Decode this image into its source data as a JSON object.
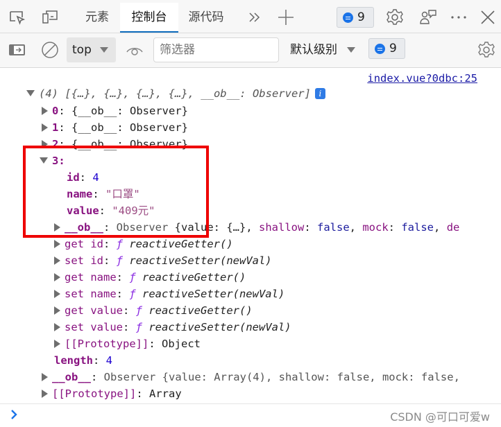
{
  "tabbar": {
    "tabs": [
      {
        "label": "元素",
        "active": false
      },
      {
        "label": "控制台",
        "active": true
      },
      {
        "label": "源代码",
        "active": false
      }
    ],
    "more_tabs_icon": "double-chevron-right-icon",
    "add_tab_icon": "plus-icon",
    "issues_count": "9",
    "accent_color": "#0f6cbd"
  },
  "toolbar": {
    "context": "top",
    "filter_placeholder": "筛选器",
    "levels_label": "默认级别",
    "issues_count": "9"
  },
  "console": {
    "source_link": "index.vue?0dbc:25",
    "summary": "(4) [{…}, {…}, {…}, {…}, __ob__: Observer]",
    "items": [
      {
        "index": "0",
        "preview": "{__ob__: Observer}"
      },
      {
        "index": "1",
        "preview": "{__ob__: Observer}"
      },
      {
        "index": "2",
        "preview": "{__ob__: Observer}"
      }
    ],
    "expanded": {
      "index": "3",
      "props": [
        {
          "key": "id",
          "value": "4"
        },
        {
          "key": "name",
          "value": "\"口罩\""
        },
        {
          "key": "value",
          "value": "\"409元\""
        }
      ],
      "ob_key": "__ob__",
      "ob_type": "Observer",
      "ob_preview_open": "{value: {…}, ",
      "ob_shallow": "shallow",
      "ob_mock": "mock",
      "ob_false": "false",
      "ob_tail": "de",
      "accessors": [
        {
          "label": "get id",
          "fn": "reactiveGetter()"
        },
        {
          "label": "set id",
          "fn": "reactiveSetter(newVal)"
        },
        {
          "label": "get name",
          "fn": "reactiveGetter()"
        },
        {
          "label": "set name",
          "fn": "reactiveSetter(newVal)"
        },
        {
          "label": "get value",
          "fn": "reactiveGetter()"
        },
        {
          "label": "set value",
          "fn": "reactiveSetter(newVal)"
        }
      ],
      "prototype_label": "[[Prototype]]",
      "prototype_value": "Object"
    },
    "length_key": "length",
    "length_value": "4",
    "array_ob_key": "__ob__",
    "array_ob_preview": "Observer {value: Array(4), shallow: false, mock: false,",
    "array_prototype_label": "[[Prototype]]",
    "array_prototype_value": "Array"
  },
  "watermark": "CSDN @可口可爱w",
  "highlight_color": "#ee0000"
}
